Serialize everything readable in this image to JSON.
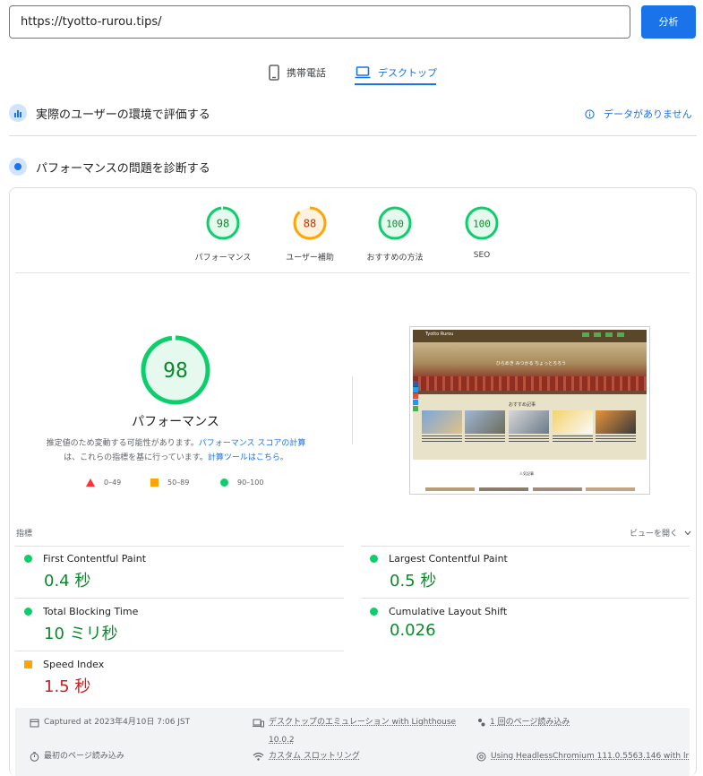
{
  "url_bar": {
    "value": "https://tyotto-rurou.tips/",
    "analyze_label": "分析"
  },
  "device_tabs": {
    "mobile": "携帯電話",
    "desktop": "デスクトップ"
  },
  "field_section": {
    "title": "実際のユーザーの環境で評価する",
    "no_data": "データがありません"
  },
  "lab_section": {
    "title": "パフォーマンスの問題を診断する"
  },
  "categories": [
    {
      "score": "98",
      "label": "パフォーマンス",
      "status": "pass"
    },
    {
      "score": "88",
      "label": "ユーザー補助",
      "status": "average"
    },
    {
      "score": "100",
      "label": "おすすめの方法",
      "status": "pass"
    },
    {
      "score": "100",
      "label": "SEO",
      "status": "pass"
    }
  ],
  "performance": {
    "score": "98",
    "title": "パフォーマンス",
    "desc_part1": "推定値のため変動する可能性があります。",
    "desc_link1": "パフォーマンス スコアの計算",
    "desc_part2": "は、これらの指標を基に行っています。",
    "desc_link2": "計算ツールはこちら。"
  },
  "legend": {
    "fail": "0–49",
    "average": "50–89",
    "pass": "90–100"
  },
  "colors": {
    "accent": "#1a73e8",
    "pass": "#0cce6b",
    "average": "#ffa400",
    "fail": "#ff4e42"
  },
  "thumbnail": {
    "site_title": "Tyotto Rurou",
    "hero_text": "ひらめき みつかる ちょっとろろう",
    "section_heading": "おすすめ記事",
    "sub_heading": "人気記事"
  },
  "metrics_header": {
    "label": "指標",
    "expand": "ビューを開く"
  },
  "metrics": [
    {
      "name": "First Contentful Paint",
      "value": "0.4 秒",
      "status": "pass"
    },
    {
      "name": "Largest Contentful Paint",
      "value": "0.5 秒",
      "status": "pass"
    },
    {
      "name": "Total Blocking Time",
      "value": "10 ミリ秒",
      "status": "pass"
    },
    {
      "name": "Cumulative Layout Shift",
      "value": "0.026",
      "status": "pass"
    },
    {
      "name": "Speed Index",
      "value": "1.5 秒",
      "status": "average"
    }
  ],
  "footer": {
    "captured": "Captured at 2023年4月10日 7:06 JST",
    "emulation_line1": "デスクトップのエミュレーション with Lighthouse",
    "emulation_line2": "10.0.2",
    "page_loads": "1 回のページ読み込み",
    "initial_load": "最初のページ読み込み",
    "throttling": "カスタム スロットリング",
    "browser": "Using HeadlessChromium 111.0.5563.146 with lr"
  }
}
